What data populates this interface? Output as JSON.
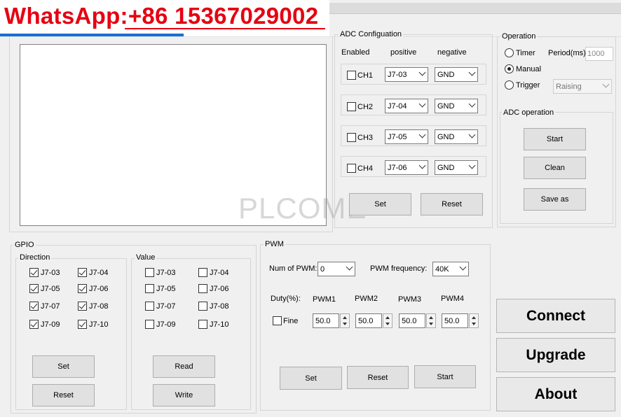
{
  "watermark": {
    "text": "WhatsApp:+86 15367029002",
    "color": "#e60012"
  },
  "bg_watermark": "PLCOME",
  "adc_config": {
    "title": "ADC Configuation",
    "col_enabled": "Enabled",
    "col_positive": "positive",
    "col_negative": "negative",
    "channels": [
      {
        "label": "CH1",
        "positive": "J7-03",
        "negative": "GND"
      },
      {
        "label": "CH2",
        "positive": "J7-04",
        "negative": "GND"
      },
      {
        "label": "CH3",
        "positive": "J7-05",
        "negative": "GND"
      },
      {
        "label": "CH4",
        "positive": "J7-06",
        "negative": "GND"
      }
    ],
    "set_label": "Set",
    "reset_label": "Reset"
  },
  "operation": {
    "title": "Operation",
    "timer_label": "Timer",
    "period_label": "Period(ms)",
    "period_placeholder": "1000",
    "manual_label": "Manual",
    "trigger_label": "Trigger",
    "trigger_value": "Raising"
  },
  "adc_operation": {
    "title": "ADC operation",
    "start_label": "Start",
    "clean_label": "Clean",
    "saveas_label": "Save as"
  },
  "gpio": {
    "title": "GPIO",
    "direction_title": "Direction",
    "value_title": "Value",
    "pins": [
      "J7-03",
      "J7-04",
      "J7-05",
      "J7-06",
      "J7-07",
      "J7-08",
      "J7-09",
      "J7-10"
    ],
    "set_label": "Set",
    "reset_label": "Reset",
    "read_label": "Read",
    "write_label": "Write"
  },
  "pwm": {
    "title": "PWM",
    "num_label": "Num of PWM:",
    "num_value": "0",
    "freq_label": "PWM frequency:",
    "freq_value": "40K",
    "duty_label": "Duty(%):",
    "fine_label": "Fine",
    "channels": [
      {
        "label": "PWM1",
        "value": "50.0"
      },
      {
        "label": "PWM2",
        "value": "50.0"
      },
      {
        "label": "PWM3",
        "value": "50.0"
      },
      {
        "label": "PWM4",
        "value": "50.0"
      }
    ],
    "set_label": "Set",
    "reset_label": "Reset",
    "start_label": "Start"
  },
  "actions": {
    "connect_label": "Connect",
    "upgrade_label": "Upgrade",
    "about_label": "About"
  }
}
